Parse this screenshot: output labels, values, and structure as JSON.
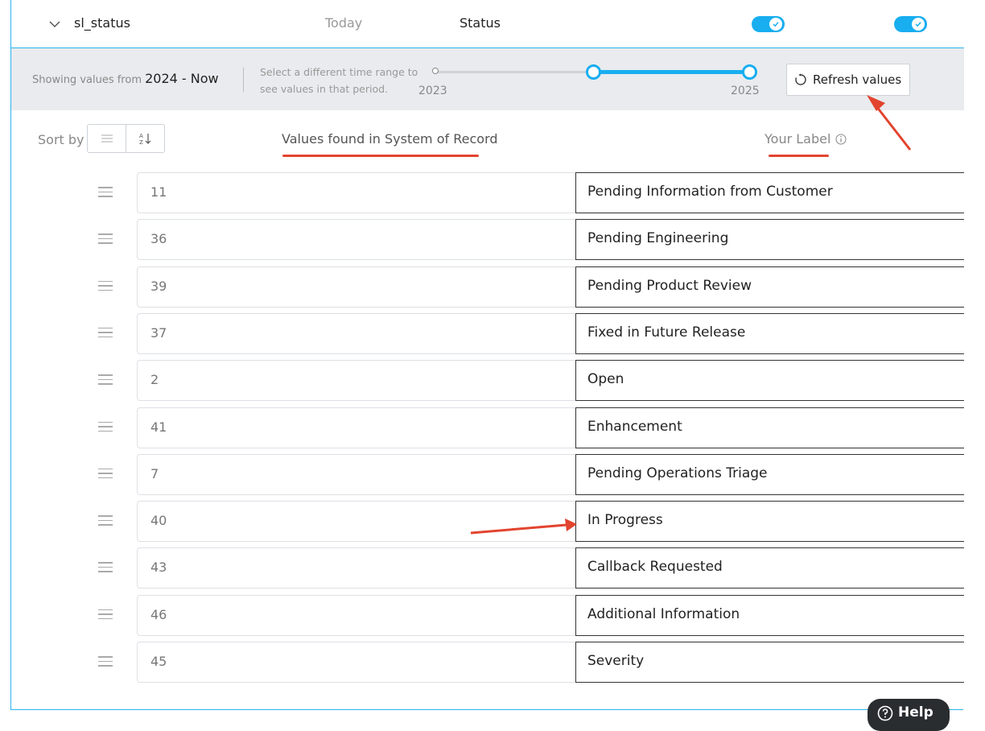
{
  "header": {
    "field_name": "sl_status",
    "col_today": "Today",
    "col_status": "Status",
    "toggle_colors": "#18aef0"
  },
  "range": {
    "showing_prefix": "Showing values from",
    "showing_value": "2024 - Now",
    "hint_line1": "Select a different time range to",
    "hint_line2": "see values in that period.",
    "start_label": "2023",
    "end_label": "2025",
    "refresh_label": "Refresh values"
  },
  "columns": {
    "sort_by": "Sort by",
    "values_header": "Values found in System of Record",
    "label_header": "Your Label"
  },
  "rows": [
    {
      "value": "11",
      "label": "Pending Information from Customer"
    },
    {
      "value": "36",
      "label": "Pending Engineering"
    },
    {
      "value": "39",
      "label": "Pending Product Review"
    },
    {
      "value": "37",
      "label": "Fixed in Future Release"
    },
    {
      "value": "2",
      "label": "Open"
    },
    {
      "value": "41",
      "label": "Enhancement"
    },
    {
      "value": "7",
      "label": "Pending Operations Triage"
    },
    {
      "value": "40",
      "label": "In Progress"
    },
    {
      "value": "43",
      "label": "Callback Requested"
    },
    {
      "value": "46",
      "label": "Additional Information"
    },
    {
      "value": "45",
      "label": "Severity"
    }
  ],
  "help": {
    "label": "Help"
  },
  "colors": {
    "accent": "#18aef0",
    "annotation": "#e2442f",
    "border": "#2bb3ee"
  }
}
